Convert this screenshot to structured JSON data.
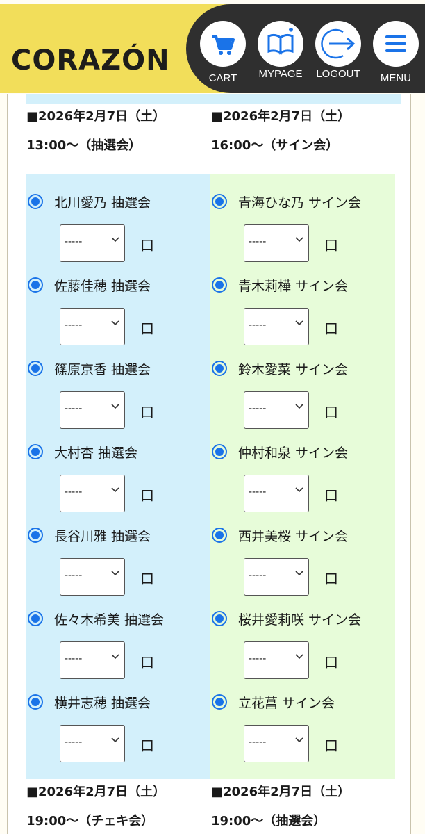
{
  "header": {
    "logo": "CORAZÓN",
    "nav": [
      {
        "label": "CART",
        "icon": "cart-icon"
      },
      {
        "label": "MYPAGE",
        "icon": "book-heart-icon"
      },
      {
        "label": "LOGOUT",
        "icon": "logout-arrow-icon"
      },
      {
        "label": "MENU",
        "icon": "hamburger-menu-icon"
      }
    ],
    "colors": {
      "yellow": "#f2de5a",
      "dark": "#2f2f2f",
      "icon_blue": "#1a73e8"
    }
  },
  "sections": {
    "left_date": "■2026年2月7日（土）",
    "left_time": "13:00〜（抽選会）",
    "right_date": "■2026年2月7日（土）",
    "right_time": "16:00〜（サイン会）"
  },
  "left_items": [
    {
      "name": "北川愛乃 抽選会",
      "value": "-----",
      "unit": "口"
    },
    {
      "name": "佐藤佳穂 抽選会",
      "value": "-----",
      "unit": "口"
    },
    {
      "name": "篠原京香 抽選会",
      "value": "-----",
      "unit": "口"
    },
    {
      "name": "大村杏 抽選会",
      "value": "-----",
      "unit": "口"
    },
    {
      "name": "長谷川雅 抽選会",
      "value": "-----",
      "unit": "口"
    },
    {
      "name": "佐々木希美 抽選会",
      "value": "-----",
      "unit": "口"
    },
    {
      "name": "横井志穂 抽選会",
      "value": "-----",
      "unit": "口"
    }
  ],
  "right_items": [
    {
      "name": "青海ひな乃 サイン会",
      "value": "-----",
      "unit": "口"
    },
    {
      "name": "青木莉樺 サイン会",
      "value": "-----",
      "unit": "口"
    },
    {
      "name": "鈴木愛菜 サイン会",
      "value": "-----",
      "unit": "口"
    },
    {
      "name": "仲村和泉 サイン会",
      "value": "-----",
      "unit": "口"
    },
    {
      "name": "西井美桜 サイン会",
      "value": "-----",
      "unit": "口"
    },
    {
      "name": "桜井愛莉咲 サイン会",
      "value": "-----",
      "unit": "口"
    },
    {
      "name": "立花菖 サイン会",
      "value": "-----",
      "unit": "口"
    }
  ],
  "bottom_sections": {
    "left_date": "■2026年2月7日（土）",
    "left_time": "19:00〜（チェキ会）",
    "right_date": "■2026年2月7日（土）",
    "right_time": "19:00〜（抽選会）"
  },
  "colors": {
    "left_bg": "#d3f0fb",
    "right_bg": "#e7fcd9",
    "radio": "#1a73e8"
  }
}
